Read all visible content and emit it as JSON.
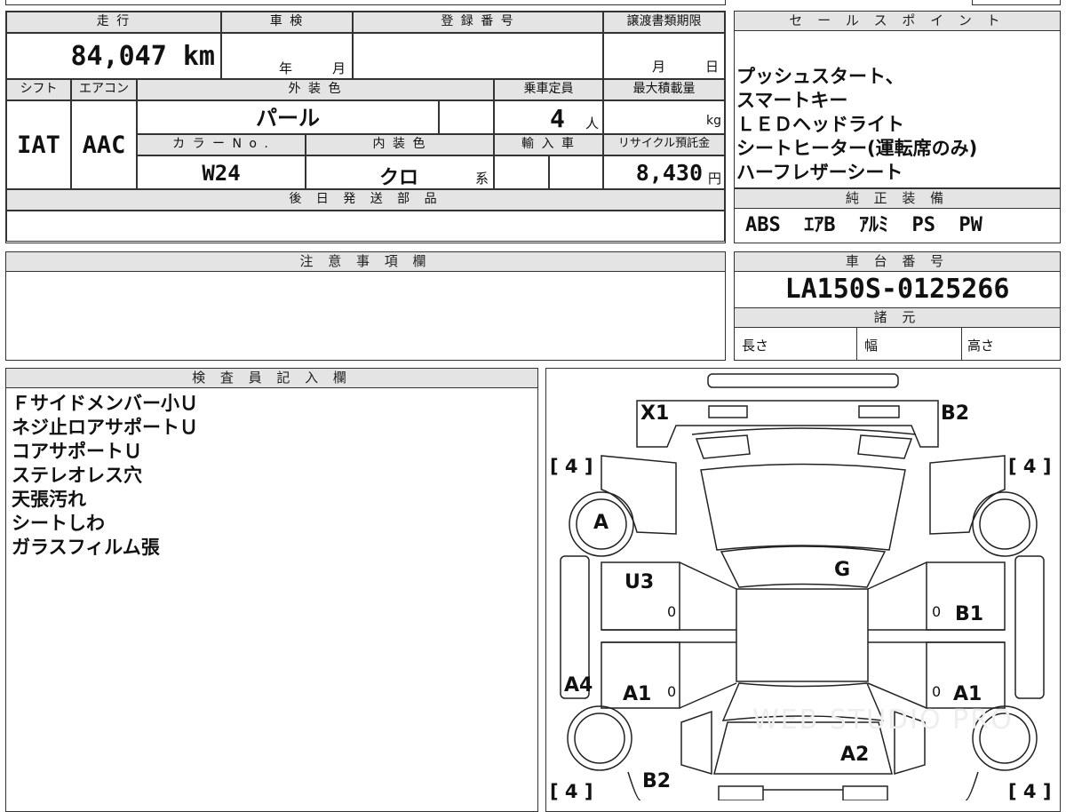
{
  "vehicle": {
    "headers": {
      "mileage": "走 行",
      "inspection": "車 検",
      "registration": "登 録 番 号",
      "transfer_deadline": "譲渡書類期限",
      "shift": "シフト",
      "aircon": "エアコン",
      "exterior_color": "外 装 色",
      "capacity": "乗車定員",
      "max_load": "最大積載量",
      "color_no": "カ ラ ー N o .",
      "interior_color": "内 装 色",
      "import": "輸 入 車",
      "recycle_fee": "リサイクル預託金",
      "later_parts": "後 日 発 送 部 品"
    },
    "mileage": "84,047 km",
    "inspection_year_unit": "年",
    "inspection_month_unit": "月",
    "transfer_month_unit": "月",
    "transfer_day_unit": "日",
    "shift": "IAT",
    "aircon": "AAC",
    "exterior_color": "パール",
    "capacity": "4",
    "capacity_unit": "人",
    "load_unit": "kg",
    "color_no": "W24",
    "interior_color": "クロ",
    "interior_suffix": "系",
    "recycle_fee": "8,430",
    "recycle_unit": "円"
  },
  "sales_points": {
    "header": "セ ー ル ス ポ イ ン ト",
    "lines": [
      "プッシュスタート、",
      "スマートキー",
      "ＬＥＤヘッドライト",
      "シートヒーター(運転席のみ)",
      "ハーフレザーシート"
    ]
  },
  "equipment": {
    "header": "純 正 装 備",
    "value": "ABS  ｴｱB  ｱﾙﾐ  PS  PW"
  },
  "notes": {
    "header": "注 意 事 項 欄"
  },
  "chassis": {
    "header": "車 台 番 号",
    "value": "LA150S-0125266"
  },
  "specs": {
    "header": "諸 元",
    "length": "長さ",
    "width": "幅",
    "height": "高さ"
  },
  "inspector": {
    "header": "検 査 員 記 入 欄",
    "lines": [
      "Ｆサイドメンバー小Ｕ",
      "ネジ止ロアサポートＵ",
      "コアサポートＵ",
      "ステレオレス穴",
      "天張汚れ",
      "シートしわ",
      "ガラスフィルム張"
    ]
  },
  "diagram": {
    "marks": {
      "x1": "X1",
      "b2_top": "B2",
      "a": "A",
      "g": "G",
      "u3": "U3",
      "b1": "B1",
      "a4": "A4",
      "a1_left": "A1",
      "a1_right": "A1",
      "a2": "A2",
      "b2_bottom": "B2"
    },
    "tire_tl": "[ 4 ]",
    "tire_tr": "[ 4 ]",
    "tire_bl": "[ 4 ]",
    "tire_br": "[ 4 ]",
    "zero_1": "0",
    "zero_2": "0",
    "zero_3": "0",
    "zero_4": "0",
    "watermark": "WEB STUDIO PRO"
  }
}
